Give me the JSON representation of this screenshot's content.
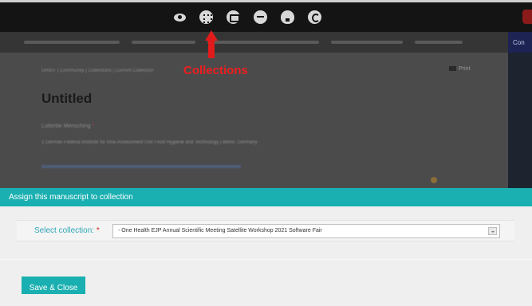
{
  "toolbar": {
    "icons": [
      "eye-icon",
      "collections-icon",
      "card-icon",
      "minus-circle-icon",
      "bulb-icon",
      "copyright-icon"
    ]
  },
  "sidebar": {
    "tab_label": "Con"
  },
  "document": {
    "breadcrumb": "ORBIT | Community | Collections | Current Collection",
    "print_label": "Print",
    "title": "Untitled",
    "author": "Lutterbe Mensching",
    "author_required": "*",
    "affiliation": "1 German Federal Institute for Risk Assessment Unit Food Hygiene and Technology | Berlin, Germany",
    "link": "Correspondence author: lutterbe.mensching@bfr.bund.de"
  },
  "annotation": {
    "label": "Collections"
  },
  "modal": {
    "title": "Assign this manuscript to collection",
    "select_label": "Select collection:",
    "required_mark": "*",
    "selected_option": "- One Health EJP Annual Scientific Meeting Satellite Workshop 2021 Software Fair",
    "save_label": "Save & Close"
  },
  "colors": {
    "accent": "#1aafb0",
    "topbar": "#141414",
    "annotation": "#e11b1b"
  }
}
